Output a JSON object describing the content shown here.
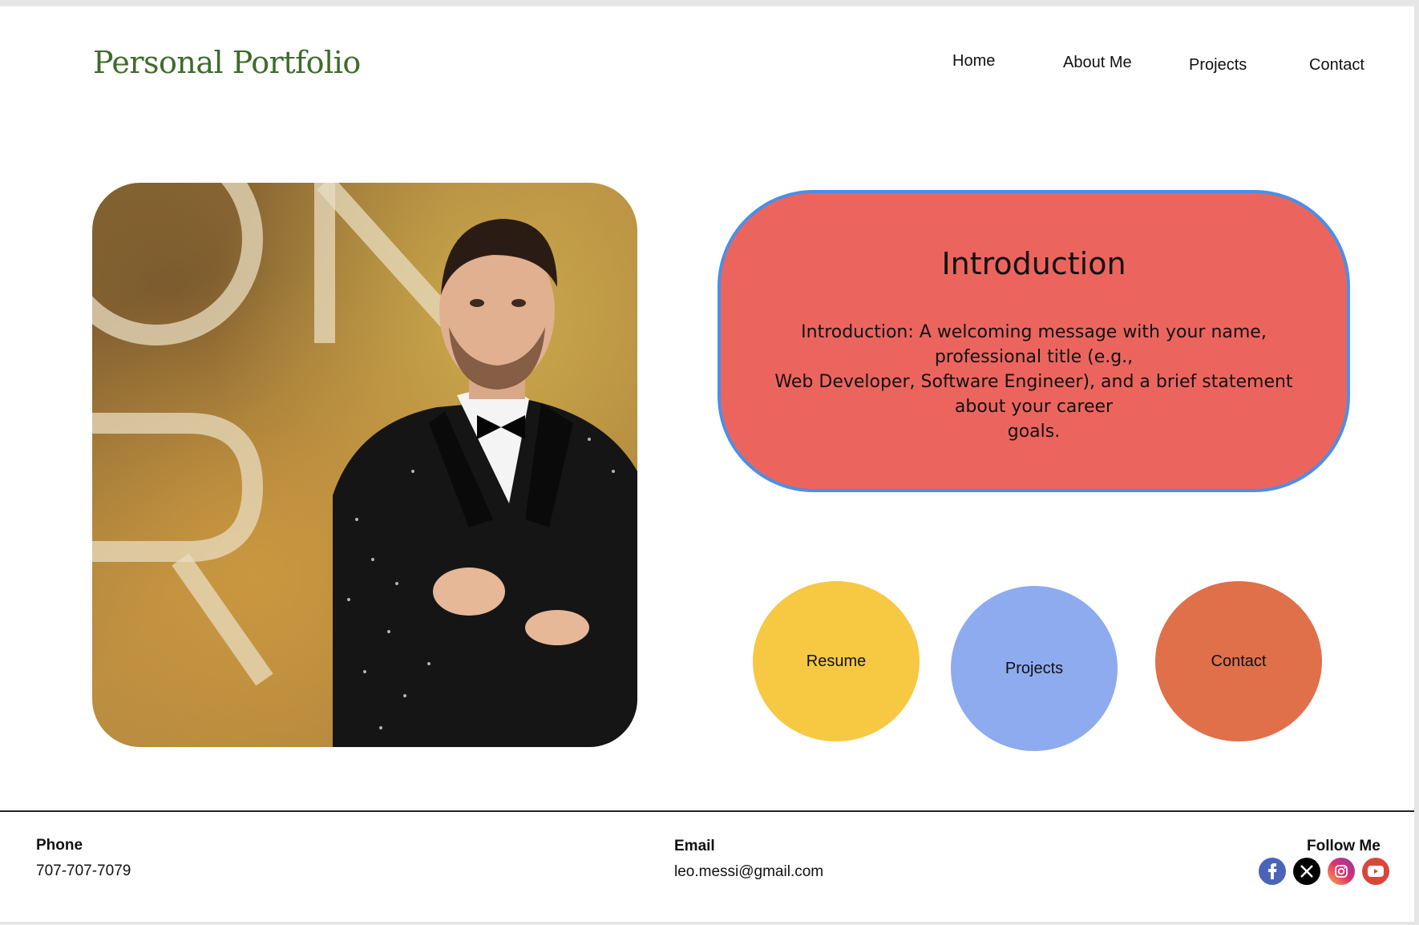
{
  "header": {
    "logo": "Personal Portfolio",
    "nav": [
      "Home",
      "About Me",
      "Projects",
      "Contact"
    ]
  },
  "intro": {
    "title": "Introduction",
    "body": "Introduction: A welcoming message with your name,\nprofessional title (e.g.,\nWeb Developer, Software Engineer), and a brief statement\nabout your career\ngoals."
  },
  "actions": {
    "resume": "Resume",
    "projects": "Projects",
    "contact": "Contact"
  },
  "footer": {
    "phone_label": "Phone",
    "phone": "707-707-7079",
    "email_label": "Email",
    "email": "leo.messi@gmail.com",
    "follow_label": "Follow Me",
    "social": [
      "facebook-icon",
      "x-icon",
      "instagram-icon",
      "youtube-icon"
    ]
  },
  "colors": {
    "logo": "#3e6b2a",
    "intro_bg": "#eb655e",
    "intro_border": "#4a8fe8",
    "resume": "#f7c842",
    "projects": "#8fabf0",
    "contact": "#e0704a"
  }
}
